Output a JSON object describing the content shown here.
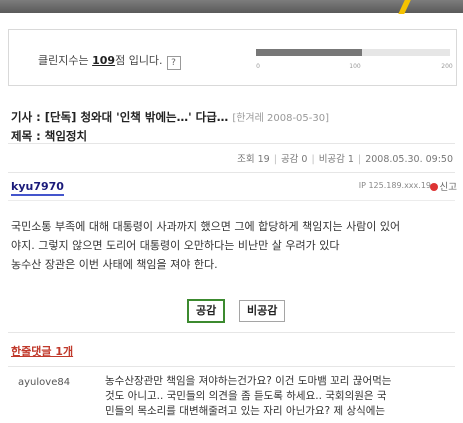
{
  "score": {
    "prefix": "클린지수는 ",
    "value": "109",
    "suffix": "점 입니다.",
    "help_label": "?",
    "fraction": 0.545,
    "scale_labels": [
      "0",
      "100",
      "200"
    ],
    "bar_color": "#777777"
  },
  "article": {
    "headline": "기사 : [단독] 청와대 '인책 밖에는…' 다급…",
    "source": "[한겨레 2008-05-30]",
    "subject": "제목 : 책임정치"
  },
  "meta": {
    "views": "조회 19",
    "shares": "공감 0",
    "disagree": "비공감 1",
    "datetime": "2008.05.30. 09:50"
  },
  "post": {
    "author": "kyu7970",
    "ip": "IP 125.189.xxx.19",
    "report_label": "신고",
    "lines": [
      "국민소통 부족에 대해 대통령이 사과까지 했으면 그에 합당하게 책임지는 사람이 있어",
      "야지. 그렇지 않으면 도리어 대통령이 오만하다는 비난만 살 우려가 있다",
      "농수산 장관은 이번 사태에 책임을 져야 한다."
    ]
  },
  "buttons": {
    "agree": "공감",
    "disagree": "비공감"
  },
  "comments": {
    "title": "한줄댓글 1개",
    "items": [
      {
        "author": "ayulove84",
        "lines": [
          "농수산장관만 책임을 져야하는건가요? 이건 도마뱀 꼬리 끊어먹는",
          "것도 아니고.. 국민들의 의견을 좀 듣도록 하세요.. 국회의원은 국",
          "민들의 목소리를 대변해줄려고 있는 자리 아닌가요? 제 상식에는"
        ]
      }
    ]
  }
}
